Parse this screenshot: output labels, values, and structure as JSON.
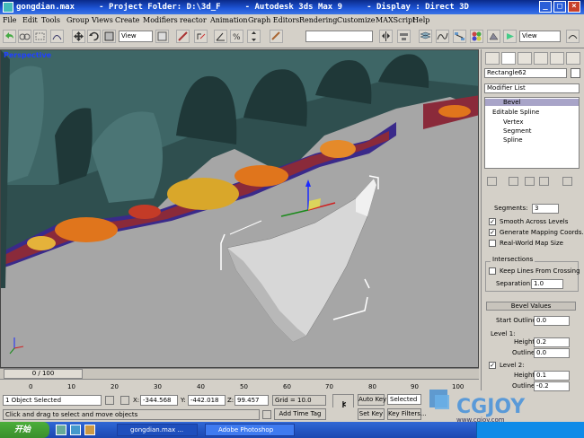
{
  "window": {
    "title": "gongdian.max     - Project Folder: D:\\3d_F     - Autodesk 3ds Max 9     - Display : Direct 3D"
  },
  "menu": [
    "File",
    "Edit",
    "Tools",
    "Group",
    "Views",
    "Create",
    "Modifiers",
    "reactor",
    "Animation",
    "Graph Editors",
    "Rendering",
    "Customize",
    "MAXScript",
    "Help"
  ],
  "toolbar": {
    "view_dropdown_1": "View",
    "view_dropdown_2": "View"
  },
  "viewport": {
    "label": "Perspective"
  },
  "command_panel": {
    "object_name": "Rectangle62",
    "modifier_list": "Modifier List",
    "stack": [
      {
        "label": "Bevel",
        "selected": true
      },
      {
        "label": "Editable Spline",
        "selected": false
      },
      {
        "label": "Vertex",
        "selected": false
      },
      {
        "label": "Segment",
        "selected": false
      },
      {
        "label": "Spline",
        "selected": false
      }
    ],
    "params": {
      "segments_label": "Segments:",
      "segments_value": "3",
      "smooth_across": "Smooth Across Levels",
      "gen_mapping": "Generate Mapping Coords.",
      "real_world": "Real-World Map Size",
      "intersections_title": "Intersections",
      "keep_lines": "Keep Lines From Crossing",
      "separation_label": "Separation:",
      "separation_value": "1.0",
      "bevel_values_title": "Bevel Values",
      "start_outline_label": "Start Outline:",
      "start_outline_value": "0.0",
      "level1_label": "Level 1:",
      "height_label": "Height:",
      "level1_height": "0.2",
      "outline_label": "Outline:",
      "level1_outline": "0.0",
      "level2_label": "Level 2:",
      "level2_height": "0.1",
      "level2_outline": "-0.2"
    }
  },
  "timeline": {
    "frame": "0 / 100",
    "ticks": [
      "0",
      "10",
      "20",
      "30",
      "40",
      "50",
      "60",
      "70",
      "80",
      "90",
      "100"
    ]
  },
  "status": {
    "selection": "1 Object Selected",
    "prompt": "Click and drag to select and move objects",
    "x_label": "X:",
    "x_value": "-344.568",
    "y_label": "Y:",
    "y_value": "-442.018",
    "z_label": "Z:",
    "z_value": "99.457",
    "grid": "Grid = 10.0",
    "add_time_tag": "Add Time Tag",
    "auto_key": "Auto Key",
    "set_key": "Set Key",
    "key_mode": "Selected",
    "key_filters": "Key Filters..."
  },
  "taskbar": {
    "start": "开始",
    "tasks": [
      "gongdian.max ...",
      "Adobe Photoshop"
    ]
  },
  "watermark": {
    "brand": "CGJOY",
    "url": "www.cgjoy.com"
  }
}
